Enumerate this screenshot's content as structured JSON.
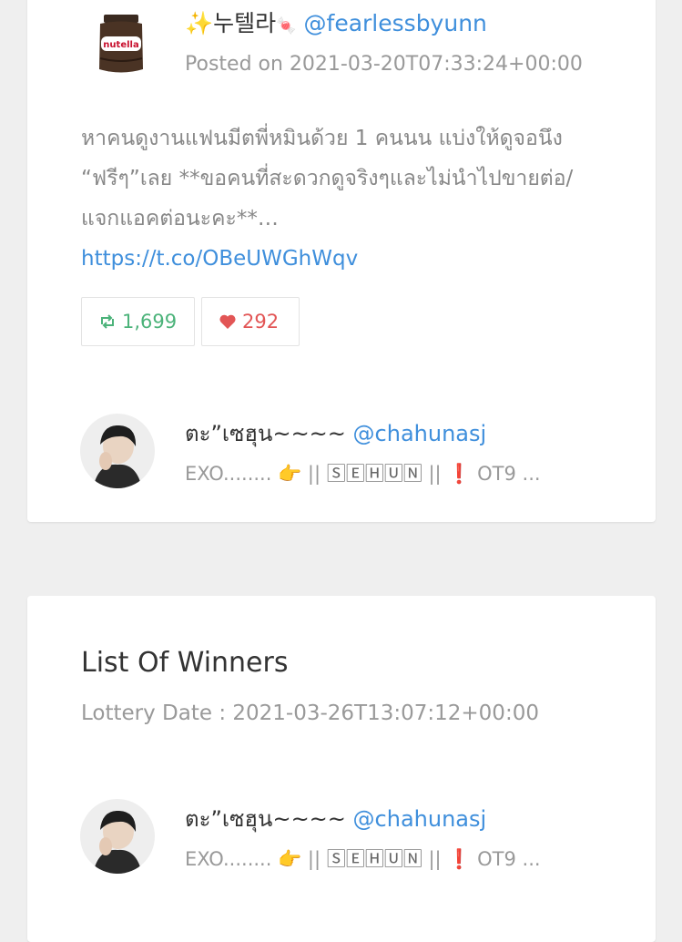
{
  "tweet": {
    "author_name": "누텔라",
    "author_handle": "@fearlessbyunn",
    "posted_label": "Posted on 2021-03-20T07:33:24+00:00",
    "text": "หาคนดูงานแฟนมีตพี่หมินด้วย 1 คนนน แบ่งให้ดูจอนึง “ฟรีๆ”เลย **ขอคนที่สะดวกดูจริงๆและไม่นำไปขายต่อ/แจกแอคต่อนะคะ**…",
    "link": "https://t.co/OBeUWGhWqv",
    "retweets": "1,699",
    "likes": "292"
  },
  "participant": {
    "name": "ตะ”เซฮุน~~~~",
    "handle": "@chahunasj",
    "bio_prefix": "EXO........",
    "bio_sehun": "🅂🄴🄷🅄🄽",
    "bio_suffix": "OT9 ..."
  },
  "winners": {
    "title": "List Of Winners",
    "lottery_label": "Lottery Date : 2021-03-26T13:07:12+00:00",
    "items": [
      {
        "name": "ตะ”เซฮุน~~~~",
        "handle": "@chahunasj",
        "bio_prefix": "EXO........",
        "bio_sehun": "🅂🄴🄷🅄🄽",
        "bio_suffix": "OT9 ..."
      }
    ]
  },
  "colors": {
    "link": "#3f8fdc",
    "retweet": "#4cb37a",
    "like": "#e25555"
  },
  "icons": [
    "sparkles-icon",
    "candy-icon",
    "retweet-icon",
    "heart-icon",
    "pointing-hand-icon",
    "exclamation-icon"
  ]
}
